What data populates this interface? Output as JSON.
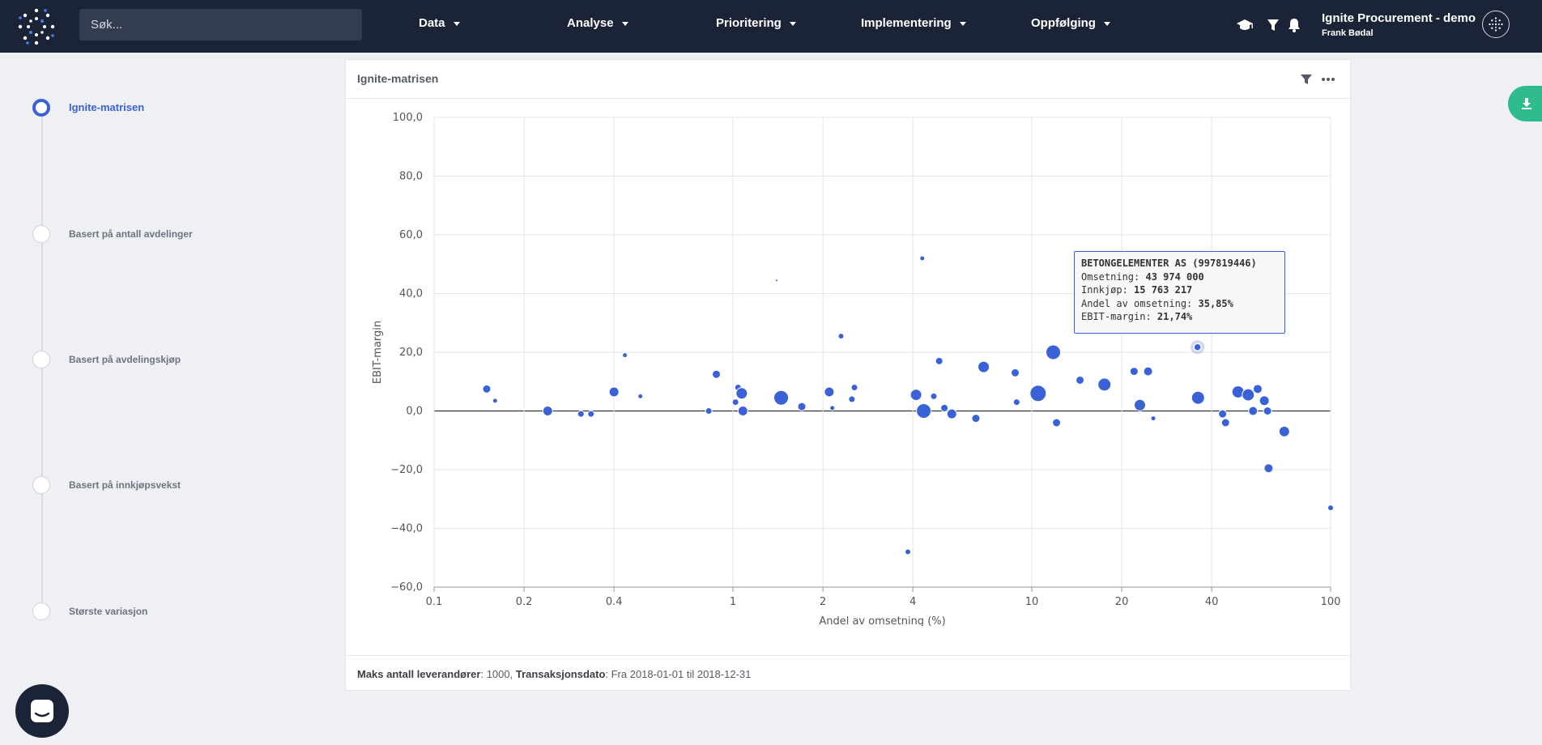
{
  "search": {
    "placeholder": "Søk..."
  },
  "nav": [
    {
      "label": "Data"
    },
    {
      "label": "Analyse"
    },
    {
      "label": "Prioritering"
    },
    {
      "label": "Implementering"
    },
    {
      "label": "Oppfølging"
    }
  ],
  "icons": [
    "graduation-cap-icon",
    "filter-icon",
    "bell-icon",
    "profile-icon",
    "filter-icon",
    "more-icon",
    "download-icon",
    "chat-icon"
  ],
  "user": {
    "company": "Ignite Procurement - demo",
    "name": "Frank Bødal"
  },
  "steps": [
    {
      "label": "Ignite-matrisen",
      "active": true
    },
    {
      "label": "Basert på antall avdelinger",
      "active": false
    },
    {
      "label": "Basert på avdelingskjøp",
      "active": false
    },
    {
      "label": "Basert på innkjøpsvekst",
      "active": false
    },
    {
      "label": "Største variasjon",
      "active": false
    }
  ],
  "card": {
    "title": "Ignite-matrisen",
    "footer": {
      "max_label": "Maks antall leverandører",
      "max_value": ": 1000, ",
      "date_label": "Transaksjonsdato",
      "date_value": ": Fra 2018-01-01 til 2018-12-31"
    }
  },
  "colors": {
    "accent": "#3a62d6",
    "nav_bg": "#1b2437",
    "download_bg": "#2ebc8f"
  },
  "chart_data": {
    "type": "scatter",
    "xlabel": "Andel av omsetning (%)",
    "ylabel": "EBIT-margin",
    "xscale": "log",
    "xlim": [
      0.1,
      100
    ],
    "ylim": [
      -60,
      100
    ],
    "xticks": [
      0.1,
      0.2,
      0.4,
      1,
      2,
      4,
      10,
      20,
      40,
      100
    ],
    "xtick_labels": [
      "0.1",
      "0.2",
      "0.4",
      "1",
      "2",
      "4",
      "10",
      "20",
      "40",
      "100"
    ],
    "yticks": [
      100,
      80,
      60,
      40,
      20,
      0,
      -20,
      -40,
      -60
    ],
    "ytick_labels": [
      "100,0",
      "80,0",
      "60,0",
      "40,0",
      "20,0",
      "0,0",
      "−20,0",
      "−40,0",
      "−60,0"
    ],
    "points": [
      {
        "x": 0.15,
        "y": 7.5,
        "s": 5
      },
      {
        "x": 0.16,
        "y": 3.5,
        "s": 3
      },
      {
        "x": 0.24,
        "y": 0.0,
        "s": 6
      },
      {
        "x": 0.31,
        "y": -1.0,
        "s": 4
      },
      {
        "x": 0.335,
        "y": -1.0,
        "s": 4
      },
      {
        "x": 0.4,
        "y": 6.5,
        "s": 6
      },
      {
        "x": 0.435,
        "y": 19.0,
        "s": 3
      },
      {
        "x": 0.49,
        "y": 5.0,
        "s": 3
      },
      {
        "x": 0.83,
        "y": 0.0,
        "s": 4
      },
      {
        "x": 0.88,
        "y": 12.5,
        "s": 5
      },
      {
        "x": 1.02,
        "y": 3.0,
        "s": 4
      },
      {
        "x": 1.04,
        "y": 8.0,
        "s": 4
      },
      {
        "x": 1.07,
        "y": 6.0,
        "s": 7
      },
      {
        "x": 1.08,
        "y": 0.0,
        "s": 6
      },
      {
        "x": 1.4,
        "y": 44.5,
        "s": 1.5
      },
      {
        "x": 1.45,
        "y": 4.5,
        "s": 9
      },
      {
        "x": 1.7,
        "y": 1.5,
        "s": 5
      },
      {
        "x": 2.1,
        "y": 6.5,
        "s": 6
      },
      {
        "x": 2.15,
        "y": 1.0,
        "s": 3
      },
      {
        "x": 2.3,
        "y": 25.5,
        "s": 3.5
      },
      {
        "x": 2.5,
        "y": 4.0,
        "s": 4
      },
      {
        "x": 2.55,
        "y": 8.0,
        "s": 4
      },
      {
        "x": 3.85,
        "y": -48.0,
        "s": 3.5
      },
      {
        "x": 4.1,
        "y": 5.5,
        "s": 7
      },
      {
        "x": 4.3,
        "y": 52.0,
        "s": 3
      },
      {
        "x": 4.35,
        "y": 0.0,
        "s": 9
      },
      {
        "x": 4.7,
        "y": 5.0,
        "s": 4
      },
      {
        "x": 4.9,
        "y": 17.0,
        "s": 4.5
      },
      {
        "x": 5.1,
        "y": 1.0,
        "s": 4.5
      },
      {
        "x": 5.4,
        "y": -1.0,
        "s": 6
      },
      {
        "x": 6.5,
        "y": -2.5,
        "s": 5
      },
      {
        "x": 6.9,
        "y": 15.0,
        "s": 7
      },
      {
        "x": 8.8,
        "y": 13.0,
        "s": 5
      },
      {
        "x": 8.9,
        "y": 3.0,
        "s": 4
      },
      {
        "x": 10.5,
        "y": 6.0,
        "s": 10
      },
      {
        "x": 11.8,
        "y": 20.0,
        "s": 9
      },
      {
        "x": 12.1,
        "y": -4.0,
        "s": 5
      },
      {
        "x": 14.5,
        "y": 10.5,
        "s": 5
      },
      {
        "x": 17.5,
        "y": 9.0,
        "s": 8
      },
      {
        "x": 22,
        "y": 13.5,
        "s": 5
      },
      {
        "x": 23,
        "y": 2.0,
        "s": 7
      },
      {
        "x": 24.5,
        "y": 13.5,
        "s": 5.5
      },
      {
        "x": 25.5,
        "y": -2.5,
        "s": 3
      },
      {
        "x": 35.85,
        "y": 21.74,
        "s": 3.5,
        "highlight": true
      },
      {
        "x": 36,
        "y": 4.5,
        "s": 8
      },
      {
        "x": 43.5,
        "y": -1.0,
        "s": 5
      },
      {
        "x": 44.5,
        "y": -4.0,
        "s": 5
      },
      {
        "x": 49,
        "y": 6.5,
        "s": 7.5
      },
      {
        "x": 53,
        "y": 5.5,
        "s": 7.5
      },
      {
        "x": 55,
        "y": 0.0,
        "s": 5.5
      },
      {
        "x": 57,
        "y": 7.5,
        "s": 5.5
      },
      {
        "x": 60,
        "y": 3.5,
        "s": 6
      },
      {
        "x": 61.5,
        "y": 0.0,
        "s": 5
      },
      {
        "x": 62,
        "y": -19.5,
        "s": 5.5
      },
      {
        "x": 70,
        "y": -7.0,
        "s": 6.5
      },
      {
        "x": 100,
        "y": -33.0,
        "s": 3.5
      }
    ]
  },
  "tooltip": {
    "title": "BETONGELEMENTER AS (997819446)",
    "rows": [
      {
        "label": "Omsetning: ",
        "value": "43 974 000"
      },
      {
        "label": "Innkjøp: ",
        "value": "15 763 217"
      },
      {
        "label": "Andel av omsetning: ",
        "value": "35,85%"
      },
      {
        "label": "EBIT-margin: ",
        "value": "21,74%"
      }
    ]
  }
}
